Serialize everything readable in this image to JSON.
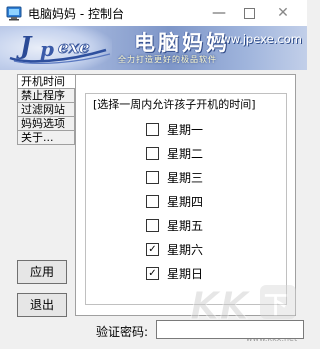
{
  "window": {
    "title": "电脑妈妈 - 控制台",
    "min_glyph": "—",
    "close_glyph": "✕"
  },
  "banner": {
    "brand_name": "电脑妈妈",
    "url": "www.jpexe.com",
    "slogan": "全力打造更好的极品软件"
  },
  "tabs": [
    {
      "label": "开机时间",
      "active": true
    },
    {
      "label": "禁止程序",
      "active": false
    },
    {
      "label": "过滤网站",
      "active": false
    },
    {
      "label": "妈妈选项",
      "active": false
    },
    {
      "label": "关于...",
      "active": false
    }
  ],
  "schedule": {
    "group_title": "[选择一周内允许孩子开机的时间]",
    "days": [
      {
        "label": "星期一",
        "checked": false
      },
      {
        "label": "星期二",
        "checked": false
      },
      {
        "label": "星期三",
        "checked": false
      },
      {
        "label": "星期四",
        "checked": false
      },
      {
        "label": "星期五",
        "checked": false
      },
      {
        "label": "星期六",
        "checked": true
      },
      {
        "label": "星期日",
        "checked": true
      }
    ]
  },
  "buttons": {
    "apply": "应用",
    "exit": "退出"
  },
  "verify": {
    "label": "验证密码:",
    "value": ""
  },
  "watermark": {
    "text": "www.kkx.net"
  },
  "colors": {
    "banner_dark": "#7e96c8",
    "banner_light": "#c2cfe9",
    "panel_bg": "#ffffff",
    "window_bg": "#f0f0f0"
  }
}
